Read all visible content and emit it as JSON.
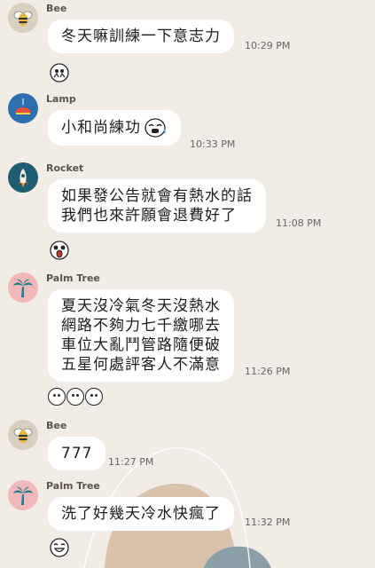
{
  "colors": {
    "background": "#f1ece6",
    "bubble": "#ffffff",
    "avatar_bee": "#d9cfc0",
    "avatar_lamp": "#2f6fb0",
    "avatar_rocket": "#1f5e72",
    "avatar_palm": "#f2b7b9"
  },
  "messages": [
    {
      "sender": "Bee",
      "avatar_icon": "bee-icon",
      "text": "冬天嘛訓練一下意志力",
      "time": "10:29 PM"
    },
    {
      "sticker_icon": "people-icon"
    },
    {
      "sender": "Lamp",
      "avatar_icon": "lamp-icon",
      "text": "小和尚練功",
      "emoji": "crying-face-emoji",
      "time": "10:33 PM"
    },
    {
      "sender": "Rocket",
      "avatar_icon": "rocket-icon",
      "text": "如果發公告就會有熱水的話\n我們也來許願會退費好了",
      "time": "11:08 PM"
    },
    {
      "sticker_icon": "shocked-face-icon"
    },
    {
      "sender": "Palm Tree",
      "avatar_icon": "palm-tree-icon",
      "text": "夏天沒冷氣冬天沒熱水\n網路不夠力七千繳哪去\n車位大亂鬥管路隨便破\n五星何處評客人不滿意",
      "time": "11:26 PM"
    },
    {
      "sticker_icon": "three-faces-icon"
    },
    {
      "sender": "Bee",
      "avatar_icon": "bee-icon",
      "text": "777",
      "time": "11:27 PM"
    },
    {
      "sender": "Palm Tree",
      "avatar_icon": "palm-tree-icon",
      "text": "洗了好幾天冷水快瘋了",
      "time": "11:32 PM"
    },
    {
      "sticker_icon": "grinning-face-icon"
    }
  ]
}
